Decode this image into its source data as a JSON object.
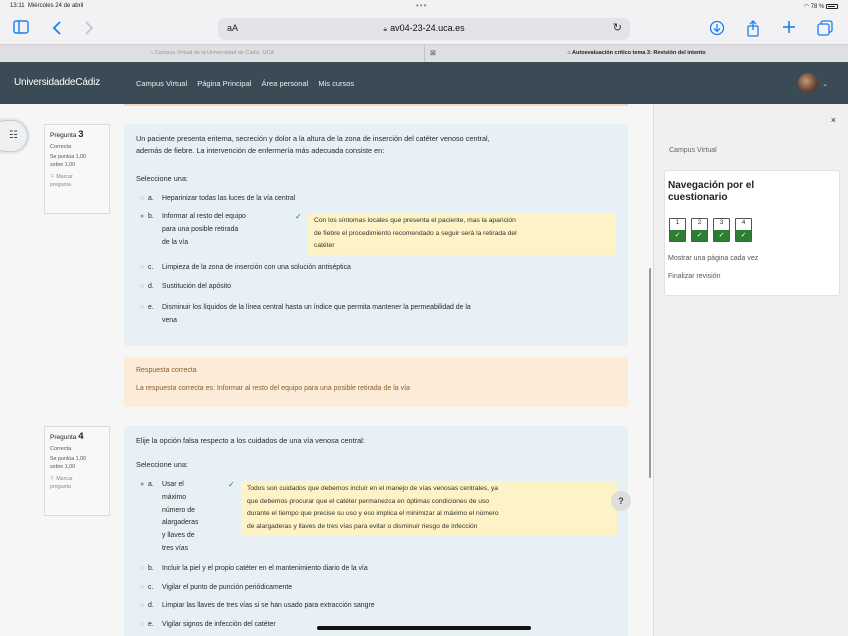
{
  "status": {
    "time": "13:11",
    "date": "Miércoles 24 de abril",
    "battery": "78 %"
  },
  "browser": {
    "aa": "aA",
    "url": "av04-23-24.uca.es",
    "tabs": [
      {
        "label": "Campus Virtual de la Universidad de Cádiz: UCA"
      },
      {
        "label": "Autoevaluación crítico tema 3: Revisión del intento"
      }
    ]
  },
  "site": {
    "brand_main": "UniversidaddeCádiz",
    "nav": [
      "Campus Virtual",
      "Página Principal",
      "Área personal",
      "Mis cursos"
    ]
  },
  "questions": [
    {
      "label": "Pregunta",
      "number": "3",
      "status": "Correcta",
      "grade_line1": "Se puntúa 1,00",
      "grade_line2": "sobre 1,00",
      "flag_line1": "Marcar",
      "flag_line2": "pregunta",
      "text_line1": "Un paciente presenta eritema, secreción y dolor a la altura de la zona de inserción del catéter venoso central,",
      "text_line2": "además de fiebre. La intervención de enfermería más adecuada consiste en:",
      "prompt": "Seleccione una:",
      "options": [
        {
          "letter": "a.",
          "lines": [
            "Heparinizar todas las luces de la vía central"
          ]
        },
        {
          "letter": "b.",
          "lines": [
            "Informar al resto del equipo",
            "para una posible retirada",
            "de la vía"
          ]
        },
        {
          "letter": "c.",
          "lines": [
            "Limpieza de la zona de inserción con una solución antiséptica"
          ]
        },
        {
          "letter": "d.",
          "lines": [
            "Sustitución del apósito"
          ]
        },
        {
          "letter": "e.",
          "lines": [
            "Disminuir los líquidos de la línea central hasta un índice que permita mantener la permeabilidad de la",
            "vena"
          ]
        }
      ],
      "feedback": [
        "Con los síntomas locales que presenta el paciente, mas la aparición",
        "de fiebre el procedimiento recomendado a seguir será la retirada del",
        "catéter"
      ],
      "answer_title": "Respuesta correcta",
      "answer_text": "La respuesta correcta es: Informar al resto del equipo para una posible retirada de la vía"
    },
    {
      "label": "Pregunta",
      "number": "4",
      "status": "Correcta",
      "grade_line1": "Se puntúa 1,00",
      "grade_line2": "sobre 1,00",
      "flag_line1": "Marcar",
      "flag_line2": "pregunta",
      "text_line1": "Elije la opción falsa respecto a los cuidados de una vía venosa central:",
      "prompt": "Seleccione una:",
      "options": [
        {
          "letter": "a.",
          "lines": [
            "Usar el",
            "máximo",
            "número de",
            "alargaderas",
            "y llaves de",
            "tres vías"
          ]
        },
        {
          "letter": "b.",
          "lines": [
            "Incluir la piel y el propio catéter en el mantenimiento diario de la vía"
          ]
        },
        {
          "letter": "c.",
          "lines": [
            "Vigilar el punto de punción periódicamente"
          ]
        },
        {
          "letter": "d.",
          "lines": [
            "Limpiar las llaves de tres vías si se han usado para extracción sangre"
          ]
        },
        {
          "letter": "e.",
          "lines": [
            "Vigilar signos de infección del catéter"
          ]
        }
      ],
      "feedback": [
        "Todos son cuidados que debemos incluir en el manejo de vías venosas centrales, ya",
        "que debemos procurar que el catéter permanezca en óptimas condiciones de uso",
        "durante el tiempo que precise su uso y eso implica el minimizar al máximo el número",
        "de alargaderas y llaves de tres vías para evitar o disminuir riesgo de infección"
      ]
    }
  ],
  "drawer": {
    "close": "×",
    "campus": "Campus Virtual",
    "title_line1": "Navegación por el",
    "title_line2": "cuestionario",
    "nav_numbers": [
      "1",
      "2",
      "3",
      "4"
    ],
    "show_one_page": "Mostrar una página cada vez",
    "finish_review": "Finalizar revisión"
  },
  "help": "?",
  "colors": {
    "navbar": "#3a4b55",
    "question_bg": "#e7f0f4",
    "feedback_bg": "#fdf3c6",
    "answer_bg": "#fbebd8",
    "correct": "#2e7d32"
  }
}
